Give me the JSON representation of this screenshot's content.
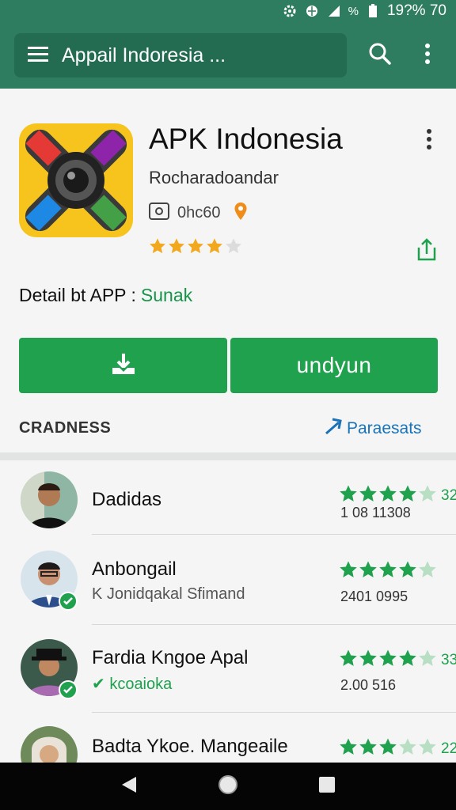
{
  "status_bar": {
    "right_text": "19?% 70",
    "signal_text": "%"
  },
  "app_bar": {
    "title": "Appail Indoresia ...",
    "icons": [
      "menu-icon",
      "search-icon",
      "more-vert-icon"
    ]
  },
  "app": {
    "name": "APK Indonesia",
    "developer": "Rocharadoandar",
    "meta_text": "0hc60",
    "rating": 4,
    "rating_max": 5
  },
  "detail": {
    "label": "Detail bt APP :",
    "value": "Sunak"
  },
  "buttons": {
    "install_label": "undyun"
  },
  "section": {
    "title": "CRADNESS",
    "link_label": "Paraesats"
  },
  "colors": {
    "primary": "#2f7d60",
    "accent": "#1fa14e",
    "link": "#1a73b8"
  },
  "reviews": [
    {
      "name": "Dadidas",
      "sub": "",
      "stars": 4,
      "score": "32",
      "count": "1 08 11308"
    },
    {
      "name": "Anbongail",
      "sub": "K Jonidqakal Sfimand",
      "stars": 4,
      "score": "",
      "count": "2401 0995"
    },
    {
      "name": "Fardia Kngoe Apal",
      "sub": "✔ kcoaioka",
      "stars": 4,
      "score": "33",
      "count": "2.00 516"
    },
    {
      "name": "Badta Ykoe. Mangeaile",
      "sub": "",
      "stars": 3,
      "score": "22",
      "count": ""
    }
  ]
}
